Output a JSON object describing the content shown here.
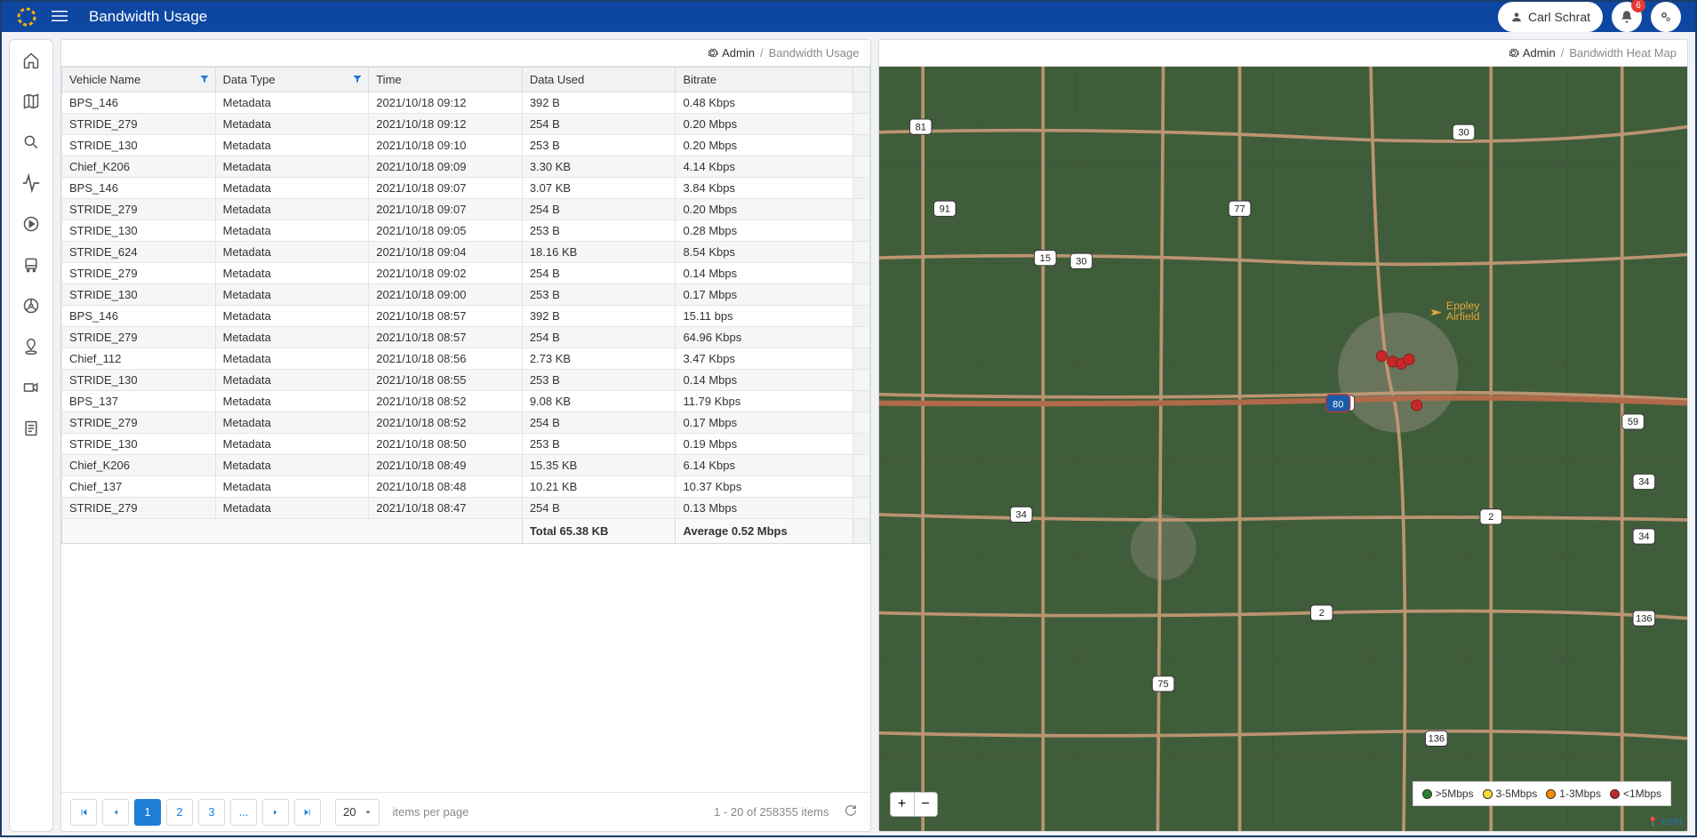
{
  "header": {
    "title": "Bandwidth Usage",
    "user_name": "Carl Schrat",
    "notification_count": "6"
  },
  "panel_left": {
    "breadcrumb_admin": "Admin",
    "breadcrumb_current": "Bandwidth Usage",
    "columns": {
      "vehicle": "Vehicle Name",
      "datatype": "Data Type",
      "time": "Time",
      "dataused": "Data Used",
      "bitrate": "Bitrate"
    },
    "rows": [
      {
        "vehicle": "BPS_146",
        "datatype": "Metadata",
        "time": "2021/10/18 09:12",
        "dataused": "392 B",
        "bitrate": "0.48 Kbps"
      },
      {
        "vehicle": "STRIDE_279",
        "datatype": "Metadata",
        "time": "2021/10/18 09:12",
        "dataused": "254 B",
        "bitrate": "0.20 Mbps"
      },
      {
        "vehicle": "STRIDE_130",
        "datatype": "Metadata",
        "time": "2021/10/18 09:10",
        "dataused": "253 B",
        "bitrate": "0.20 Mbps"
      },
      {
        "vehicle": "Chief_K206",
        "datatype": "Metadata",
        "time": "2021/10/18 09:09",
        "dataused": "3.30 KB",
        "bitrate": "4.14 Kbps"
      },
      {
        "vehicle": "BPS_146",
        "datatype": "Metadata",
        "time": "2021/10/18 09:07",
        "dataused": "3.07 KB",
        "bitrate": "3.84 Kbps"
      },
      {
        "vehicle": "STRIDE_279",
        "datatype": "Metadata",
        "time": "2021/10/18 09:07",
        "dataused": "254 B",
        "bitrate": "0.20 Mbps"
      },
      {
        "vehicle": "STRIDE_130",
        "datatype": "Metadata",
        "time": "2021/10/18 09:05",
        "dataused": "253 B",
        "bitrate": "0.28 Mbps"
      },
      {
        "vehicle": "STRIDE_624",
        "datatype": "Metadata",
        "time": "2021/10/18 09:04",
        "dataused": "18.16 KB",
        "bitrate": "8.54 Kbps"
      },
      {
        "vehicle": "STRIDE_279",
        "datatype": "Metadata",
        "time": "2021/10/18 09:02",
        "dataused": "254 B",
        "bitrate": "0.14 Mbps"
      },
      {
        "vehicle": "STRIDE_130",
        "datatype": "Metadata",
        "time": "2021/10/18 09:00",
        "dataused": "253 B",
        "bitrate": "0.17 Mbps"
      },
      {
        "vehicle": "BPS_146",
        "datatype": "Metadata",
        "time": "2021/10/18 08:57",
        "dataused": "392 B",
        "bitrate": "15.11 bps"
      },
      {
        "vehicle": "STRIDE_279",
        "datatype": "Metadata",
        "time": "2021/10/18 08:57",
        "dataused": "254 B",
        "bitrate": "64.96 Kbps"
      },
      {
        "vehicle": "Chief_112",
        "datatype": "Metadata",
        "time": "2021/10/18 08:56",
        "dataused": "2.73 KB",
        "bitrate": "3.47 Kbps"
      },
      {
        "vehicle": "STRIDE_130",
        "datatype": "Metadata",
        "time": "2021/10/18 08:55",
        "dataused": "253 B",
        "bitrate": "0.14 Mbps"
      },
      {
        "vehicle": "BPS_137",
        "datatype": "Metadata",
        "time": "2021/10/18 08:52",
        "dataused": "9.08 KB",
        "bitrate": "11.79 Kbps"
      },
      {
        "vehicle": "STRIDE_279",
        "datatype": "Metadata",
        "time": "2021/10/18 08:52",
        "dataused": "254 B",
        "bitrate": "0.17 Mbps"
      },
      {
        "vehicle": "STRIDE_130",
        "datatype": "Metadata",
        "time": "2021/10/18 08:50",
        "dataused": "253 B",
        "bitrate": "0.19 Mbps"
      },
      {
        "vehicle": "Chief_K206",
        "datatype": "Metadata",
        "time": "2021/10/18 08:49",
        "dataused": "15.35 KB",
        "bitrate": "6.14 Kbps"
      },
      {
        "vehicle": "Chief_137",
        "datatype": "Metadata",
        "time": "2021/10/18 08:48",
        "dataused": "10.21 KB",
        "bitrate": "10.37 Kbps"
      },
      {
        "vehicle": "STRIDE_279",
        "datatype": "Metadata",
        "time": "2021/10/18 08:47",
        "dataused": "254 B",
        "bitrate": "0.13 Mbps"
      }
    ],
    "footer": {
      "total": "Total 65.38 KB",
      "average": "Average 0.52 Mbps"
    },
    "pager": {
      "pages": [
        "1",
        "2",
        "3",
        "..."
      ],
      "active_page": "1",
      "page_size": "20",
      "items_label": "items per page",
      "summary": "1 - 20 of 258355 items"
    }
  },
  "panel_right": {
    "breadcrumb_admin": "Admin",
    "breadcrumb_current": "Bandwidth Heat Map",
    "legend": {
      "g5": ">5Mbps",
      "g3": "3-5Mbps",
      "g1": "1-3Mbps",
      "lt1": "<1Mbps"
    },
    "airport_label": "Eppley Airfield",
    "attribution": "ESRI",
    "route_shields": [
      "81",
      "91",
      "15",
      "30",
      "30",
      "77",
      "80",
      "59",
      "34",
      "34",
      "2",
      "34",
      "2",
      "75",
      "136",
      "136"
    ]
  }
}
